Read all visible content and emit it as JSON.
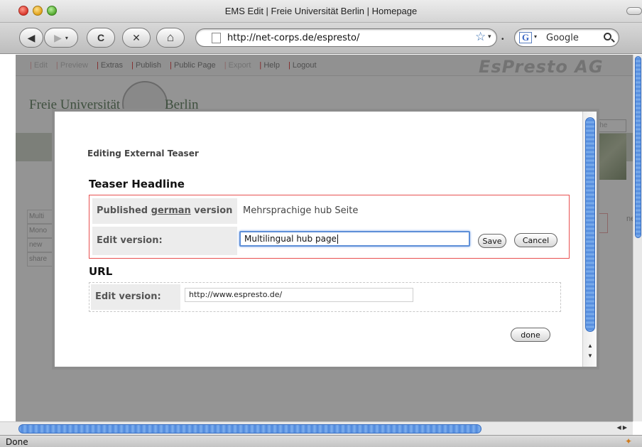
{
  "window": {
    "title": "EMS Edit | Freie Universität Berlin | Homepage"
  },
  "toolbar": {
    "back_icon": "◀",
    "forward_icon": "▶",
    "reload_icon": "C",
    "stop_icon": "✕",
    "home_icon": "⌂",
    "url": "http://net-corps.de/espresto/",
    "search_engine_icon": "G",
    "search_placeholder": "Google"
  },
  "cms": {
    "menu": [
      {
        "label": "Edit",
        "enabled": false
      },
      {
        "label": "Preview",
        "enabled": false
      },
      {
        "label": "Extras",
        "enabled": true
      },
      {
        "label": "Publish",
        "enabled": true
      },
      {
        "label": "Public Page",
        "enabled": true
      },
      {
        "label": "Export",
        "enabled": false
      },
      {
        "label": "Help",
        "enabled": true
      },
      {
        "label": "Logout",
        "enabled": true
      }
    ],
    "logo": "EsPresto AG"
  },
  "site": {
    "name_left": "Freie Universität",
    "name_right": "Berlin",
    "search_stub": "Suche",
    "left_list": [
      "Multi",
      "Mono",
      "new",
      "share"
    ],
    "right_text": "ne"
  },
  "modal": {
    "heading": "Editing External Teaser",
    "headline_section": {
      "title": "Teaser Headline",
      "published_label_pre": "Published ",
      "published_label_link": "german",
      "published_label_post": " version",
      "published_value": "Mehrsprachige hub Seite",
      "edit_label": "Edit version:",
      "edit_value": "Multilingual hub page",
      "save_label": "Save",
      "cancel_label": "Cancel"
    },
    "url_section": {
      "title": "URL",
      "edit_label": "Edit version:",
      "edit_value": "http://www.espresto.de/"
    },
    "done_label": "done"
  },
  "status": {
    "text": "Done"
  }
}
